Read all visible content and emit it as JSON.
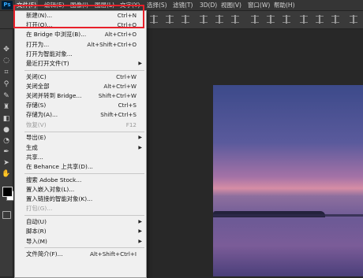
{
  "app": {
    "logo": "Ps"
  },
  "menubar": {
    "items": [
      "文件(F)",
      "编辑(E)",
      "图像(I)",
      "图层(L)",
      "文字(Y)",
      "选择(S)",
      "滤镜(T)",
      "3D(D)",
      "视图(V)",
      "窗口(W)",
      "帮助(H)"
    ],
    "active_index": 0
  },
  "file_menu": {
    "items": [
      {
        "label": "新建(N)...",
        "shortcut": "Ctrl+N"
      },
      {
        "label": "打开(O)...",
        "shortcut": "Ctrl+O"
      },
      {
        "label": "在 Bridge 中浏览(B)...",
        "shortcut": "Alt+Ctrl+O"
      },
      {
        "label": "打开为...",
        "shortcut": "Alt+Shift+Ctrl+O"
      },
      {
        "label": "打开为智能对象...",
        "shortcut": ""
      },
      {
        "label": "最近打开文件(T)",
        "shortcut": "",
        "submenu": true
      },
      {
        "sep": true
      },
      {
        "label": "关闭(C)",
        "shortcut": "Ctrl+W"
      },
      {
        "label": "关闭全部",
        "shortcut": "Alt+Ctrl+W"
      },
      {
        "label": "关闭并转到 Bridge...",
        "shortcut": "Shift+Ctrl+W"
      },
      {
        "label": "存储(S)",
        "shortcut": "Ctrl+S"
      },
      {
        "label": "存储为(A)...",
        "shortcut": "Shift+Ctrl+S"
      },
      {
        "label": "恢复(V)",
        "shortcut": "F12",
        "disabled": true
      },
      {
        "sep": true
      },
      {
        "label": "导出(E)",
        "shortcut": "",
        "submenu": true
      },
      {
        "label": "生成",
        "shortcut": "",
        "submenu": true
      },
      {
        "label": "共享...",
        "shortcut": ""
      },
      {
        "label": "在 Behance 上共享(D)...",
        "shortcut": ""
      },
      {
        "sep": true
      },
      {
        "label": "搜索 Adobe Stock...",
        "shortcut": ""
      },
      {
        "label": "置入嵌入对象(L)...",
        "shortcut": ""
      },
      {
        "label": "置入链接的智能对象(K)...",
        "shortcut": ""
      },
      {
        "label": "打包(G)...",
        "shortcut": "",
        "disabled": true
      },
      {
        "sep": true
      },
      {
        "label": "自动(U)",
        "shortcut": "",
        "submenu": true
      },
      {
        "label": "脚本(R)",
        "shortcut": "",
        "submenu": true
      },
      {
        "label": "导入(M)",
        "shortcut": "",
        "submenu": true
      },
      {
        "sep": true
      },
      {
        "label": "文件简介(F)...",
        "shortcut": "Alt+Shift+Ctrl+I"
      }
    ]
  },
  "tools": [
    "move-icon",
    "lasso-icon",
    "crop-icon",
    "eyedropper-icon",
    "brush-icon",
    "stamp-icon",
    "eraser-icon",
    "blur-icon",
    "dodge-icon",
    "pen-icon",
    "type-icon",
    "path-select-icon",
    "hand-icon"
  ],
  "colors": {
    "highlight": "#e8202a",
    "menu_bg": "#f0f0f0",
    "chrome": "#353535"
  }
}
